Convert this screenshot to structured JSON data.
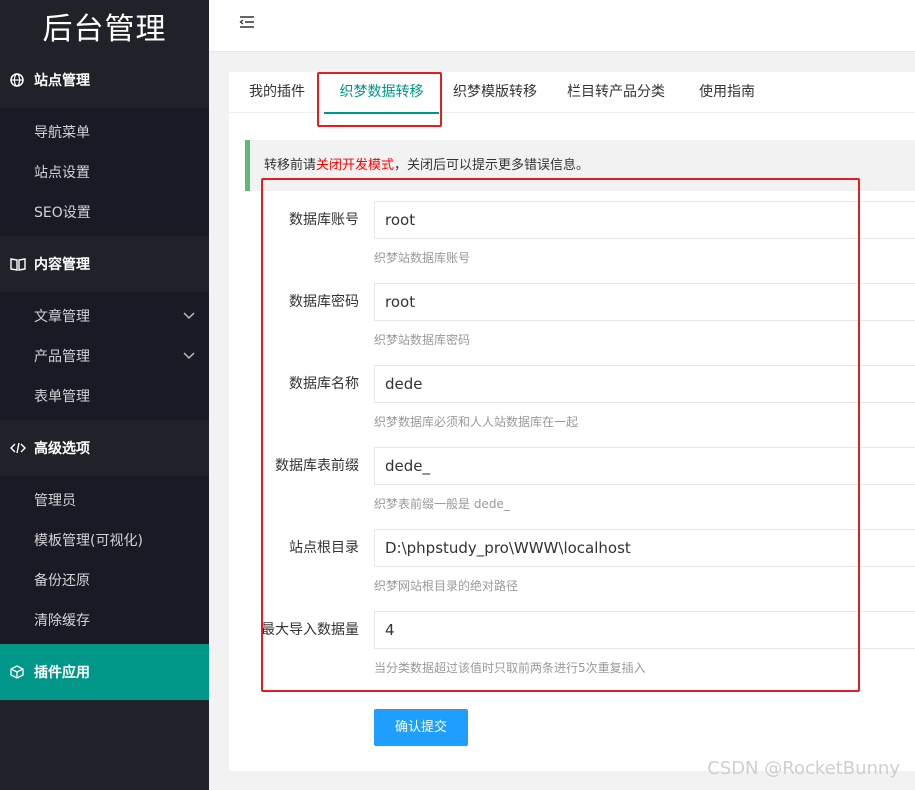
{
  "logo": "后台管理",
  "sidebar": {
    "groups": [
      {
        "label": "站点管理",
        "items": [
          "导航菜单",
          "站点设置",
          "SEO设置"
        ]
      },
      {
        "label": "内容管理",
        "items": [
          "文章管理",
          "产品管理",
          "表单管理"
        ]
      },
      {
        "label": "高级选项",
        "items": [
          "管理员",
          "模板管理(可视化)",
          "备份还原",
          "清除缓存"
        ]
      },
      {
        "label": "插件应用",
        "items": []
      }
    ]
  },
  "tabs": [
    "我的插件",
    "织梦数据转移",
    "织梦模版转移",
    "栏目转产品分类",
    "使用指南"
  ],
  "tip": {
    "before": "转移前请",
    "highlight": "关闭开发模式",
    "after": "，关闭后可以提示更多错误信息。"
  },
  "form": {
    "fields": [
      {
        "label": "数据库账号",
        "value": "root",
        "hint": "织梦站数据库账号"
      },
      {
        "label": "数据库密码",
        "value": "root",
        "hint": "织梦站数据库密码"
      },
      {
        "label": "数据库名称",
        "value": "dede",
        "hint": "织梦数据库必须和人人站数据库在一起"
      },
      {
        "label": "数据库表前缀",
        "value": "dede_",
        "hint": "织梦表前缀一般是 dede_"
      },
      {
        "label": "站点根目录",
        "value": "D:\\phpstudy_pro\\WWW\\localhost",
        "hint": "织梦网站根目录的绝对路径"
      },
      {
        "label": "最大导入数据量",
        "value": "4",
        "hint": "当分类数据超过该值时只取前两条进行5次重复插入"
      }
    ],
    "submit_label": "确认提交"
  },
  "watermark": "CSDN @RocketBunny",
  "colors": {
    "sidebar": "#20222a",
    "accent": "#009688",
    "submit": "#1e9fff",
    "annotation": "#e02020"
  }
}
